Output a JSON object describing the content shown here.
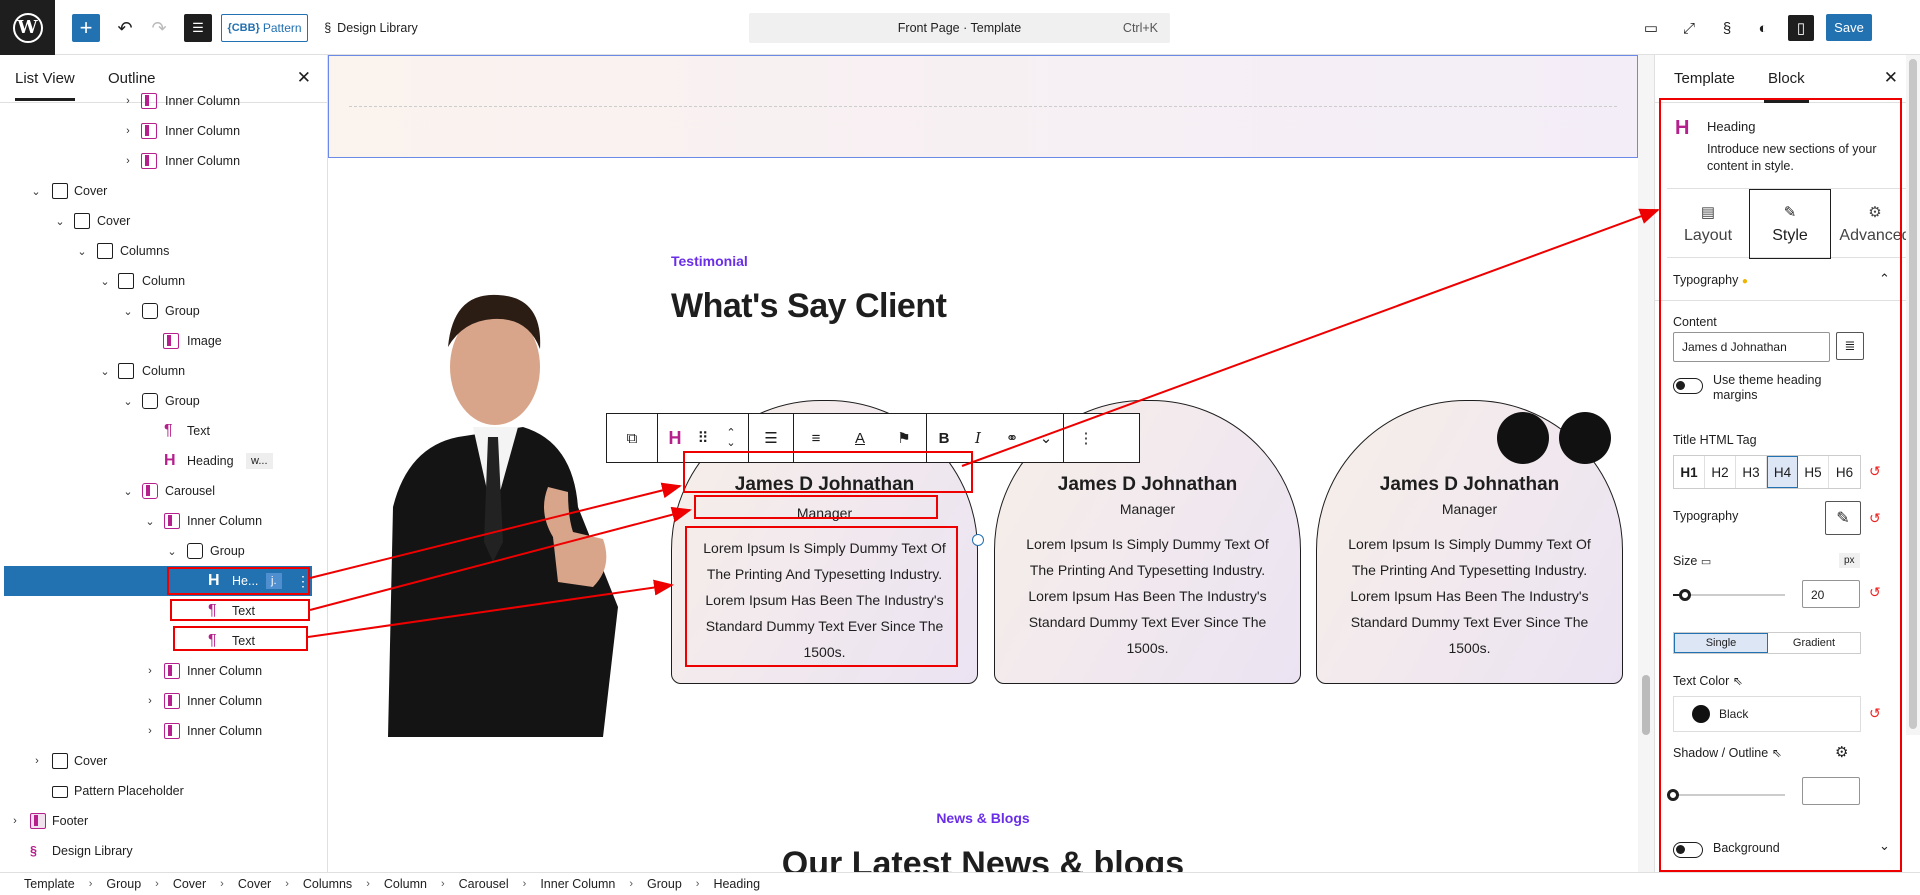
{
  "header": {
    "pattern_label": "Pattern",
    "pattern_badge": "{CBB}",
    "design_library": "Design Library",
    "doc_title": "Front Page · Template",
    "shortcut": "Ctrl+K",
    "save": "Save"
  },
  "left_panel": {
    "tabs": [
      "List View",
      "Outline"
    ],
    "rows": [
      {
        "label": "Inner Column"
      },
      {
        "label": "Inner Column"
      },
      {
        "label": "Inner Column"
      },
      {
        "label": "Cover"
      },
      {
        "label": "Cover"
      },
      {
        "label": "Columns"
      },
      {
        "label": "Column"
      },
      {
        "label": "Group"
      },
      {
        "label": "Image"
      },
      {
        "label": "Column"
      },
      {
        "label": "Group"
      },
      {
        "label": "Text"
      },
      {
        "label": "Heading",
        "badge": "w..."
      },
      {
        "label": "Carousel"
      },
      {
        "label": "Inner Column"
      },
      {
        "label": "Group"
      },
      {
        "label": "He...",
        "badge": "j."
      },
      {
        "label": "Text"
      },
      {
        "label": "Text"
      },
      {
        "label": "Inner Column"
      },
      {
        "label": "Inner Column"
      },
      {
        "label": "Inner Column"
      },
      {
        "label": "Cover"
      },
      {
        "label": "Pattern Placeholder"
      },
      {
        "label": "Footer"
      },
      {
        "label": "Design Library"
      }
    ]
  },
  "canvas": {
    "eyebrow": "Testimonial",
    "title": "What's Say Client",
    "cards": [
      {
        "name": "James D Johnathan",
        "role": "Manager",
        "body": "Lorem Ipsum Is Simply Dummy Text Of The Printing And Typesetting Industry. Lorem Ipsum Has Been The Industry's Standard Dummy Text Ever Since The 1500s."
      },
      {
        "name": "James D Johnathan",
        "role": "Manager",
        "body": "Lorem Ipsum Is Simply Dummy Text Of The Printing And Typesetting Industry. Lorem Ipsum Has Been The Industry's Standard Dummy Text Ever Since The 1500s."
      },
      {
        "name": "James D Johnathan",
        "role": "Manager",
        "body": "Lorem Ipsum Is Simply Dummy Text Of The Printing And Typesetting Industry. Lorem Ipsum Has Been The Industry's Standard Dummy Text Ever Since The 1500s."
      }
    ],
    "news_eyebrow": "News & Blogs",
    "news_title": "Our Latest News & blogs"
  },
  "right_panel": {
    "tabs": [
      "Template",
      "Block"
    ],
    "block_name": "Heading",
    "block_desc": "Introduce new sections of your content in style.",
    "inner_tabs": [
      "Layout",
      "Style",
      "Advanced"
    ],
    "typography_section": "Typography",
    "content_label": "Content",
    "content_value": "James d Johnathan",
    "theme_margins": "Use theme heading margins",
    "title_tag_label": "Title HTML Tag",
    "tags": [
      "H1",
      "H2",
      "H3",
      "H4",
      "H5",
      "H6"
    ],
    "selected_tag": "H4",
    "typography_label": "Typography",
    "size_label": "Size",
    "size_unit": "px",
    "size_value": "20",
    "seg": [
      "Single",
      "Gradient"
    ],
    "text_color_label": "Text Color",
    "text_color_value": "Black",
    "shadow_label": "Shadow / Outline",
    "background_label": "Background"
  },
  "breadcrumbs": [
    "Template",
    "Group",
    "Cover",
    "Cover",
    "Columns",
    "Column",
    "Carousel",
    "Inner Column",
    "Group",
    "Heading"
  ],
  "colors": {
    "accent": "#2271b1",
    "eyebrow": "#6a2ee8",
    "annotation": "#e00000"
  }
}
